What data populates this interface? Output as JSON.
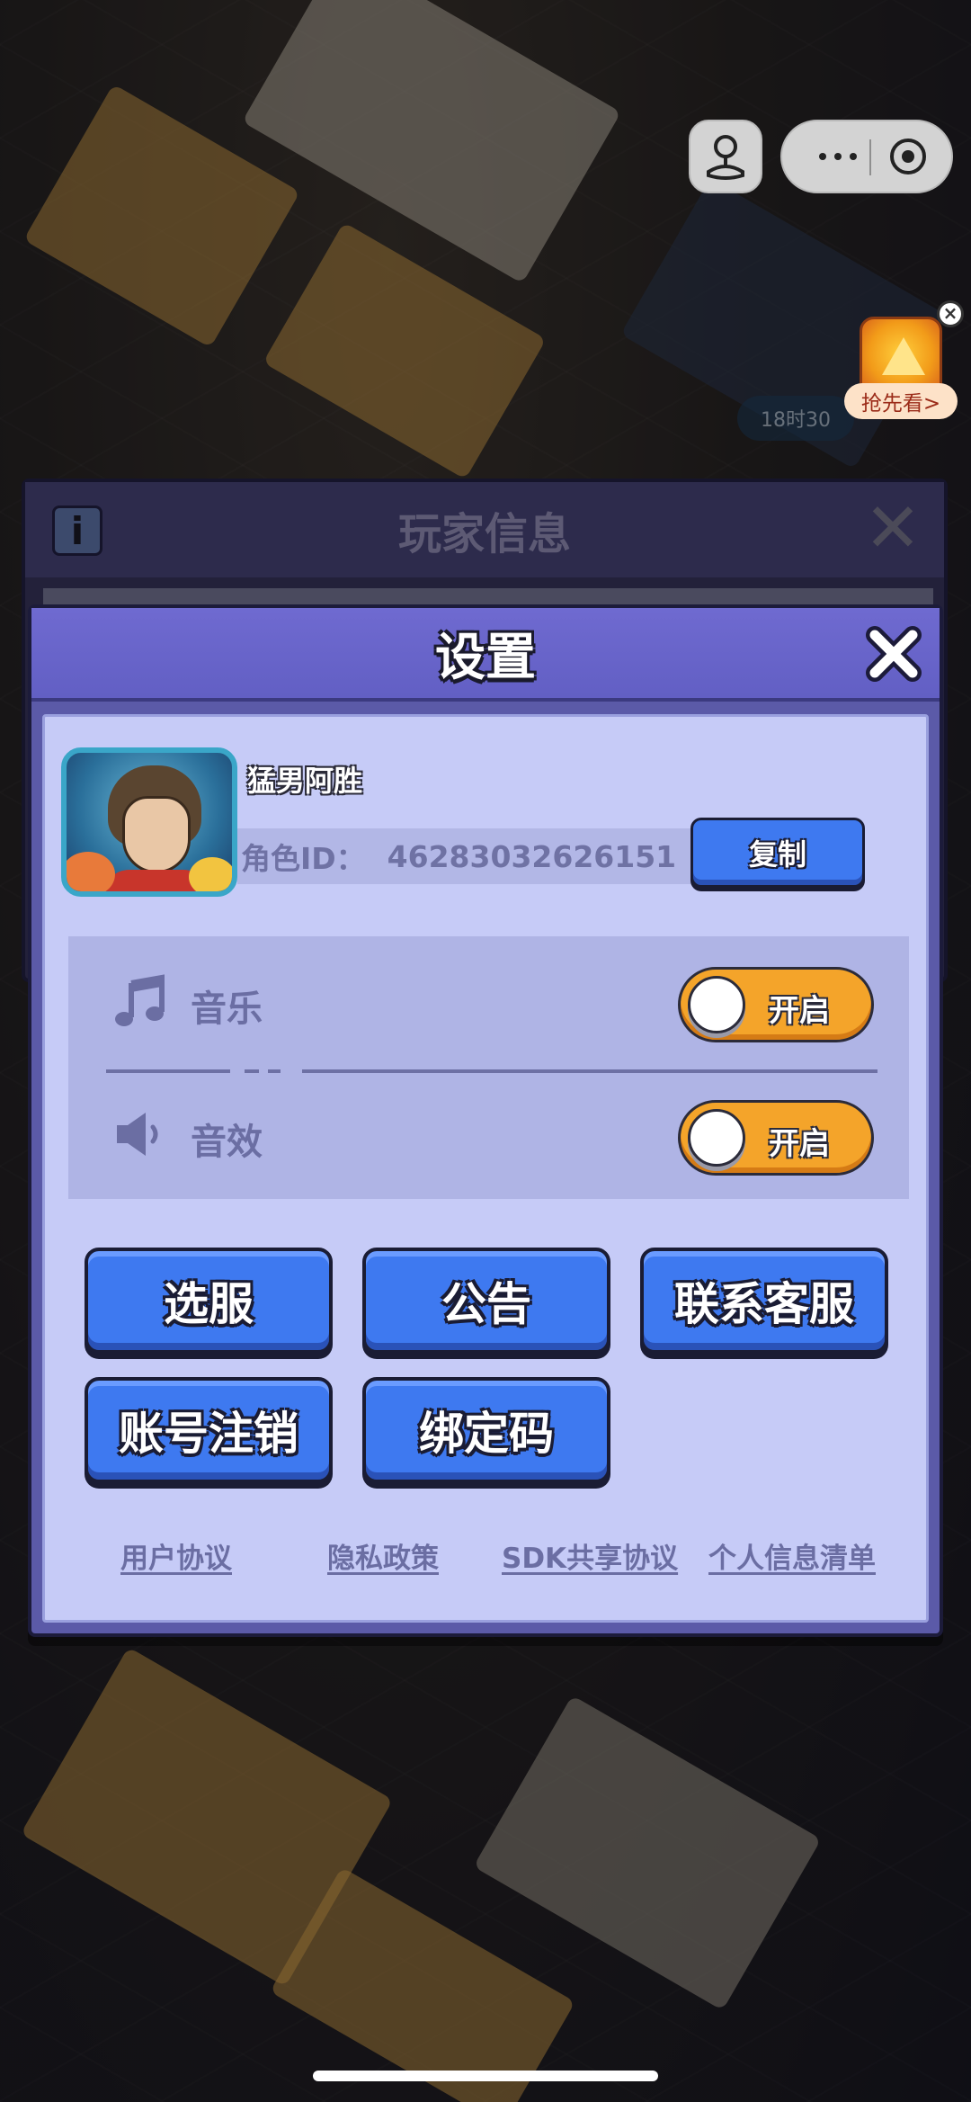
{
  "player_info": {
    "title": "玩家信息"
  },
  "promo": {
    "label": "抢先看>",
    "timer": "18时30"
  },
  "settings": {
    "title": "设置",
    "profile": {
      "nickname": "猛男阿胜",
      "id_label": "角色ID：",
      "id_value": "46283032626151",
      "copy_label": "复制"
    },
    "sound": {
      "music": {
        "label": "音乐",
        "state": "开启",
        "icon": "music-note-icon"
      },
      "sfx": {
        "label": "音效",
        "state": "开启",
        "icon": "speaker-icon"
      }
    },
    "buttons": {
      "select_server": "选服",
      "notice": "公告",
      "customer_service": "联系客服",
      "delete_account": "账号注销",
      "bind_code": "绑定码"
    },
    "links": {
      "user_agreement": "用户协议",
      "privacy_policy": "隐私政策",
      "sdk_sharing": "SDK共享协议",
      "personal_info_list": "个人信息清单"
    }
  },
  "colors": {
    "header": "#6f6ad0",
    "panel_body": "#c6cbf7",
    "button_blue": "#3e79f0",
    "toggle_on": "#f4a42a"
  }
}
